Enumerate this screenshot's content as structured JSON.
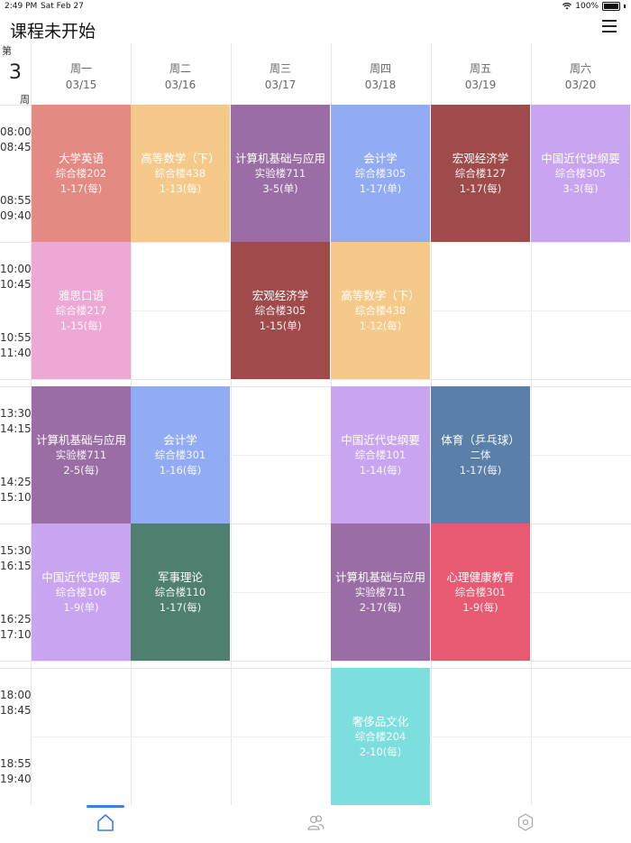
{
  "status_bar": {
    "time": "2:49 PM",
    "date": "Sat Feb 27",
    "battery": "100%"
  },
  "header": {
    "title": "课程未开始"
  },
  "week": {
    "prefix": "第",
    "number": "3",
    "suffix": "周"
  },
  "days": [
    {
      "name": "周一",
      "date": "03/15"
    },
    {
      "name": "周二",
      "date": "03/16"
    },
    {
      "name": "周三",
      "date": "03/17"
    },
    {
      "name": "周四",
      "date": "03/18"
    },
    {
      "name": "周五",
      "date": "03/19"
    },
    {
      "name": "周六",
      "date": "03/20"
    }
  ],
  "periods": [
    {
      "start": "08:00",
      "end": "08:45"
    },
    {
      "start": "08:55",
      "end": "09:40"
    },
    {
      "start": "10:00",
      "end": "10:45"
    },
    {
      "start": "10:55",
      "end": "11:40"
    },
    {
      "start": "13:30",
      "end": "14:15"
    },
    {
      "start": "14:25",
      "end": "15:10"
    },
    {
      "start": "15:30",
      "end": "16:15"
    },
    {
      "start": "16:25",
      "end": "17:10"
    },
    {
      "start": "18:00",
      "end": "18:45"
    },
    {
      "start": "18:55",
      "end": "19:40"
    }
  ],
  "courses": [
    {
      "day": 0,
      "block": 0,
      "name": "大学英语",
      "room": "综合楼202",
      "weeks": "1-17(每)",
      "color": "#e58a82"
    },
    {
      "day": 1,
      "block": 0,
      "name": "高等数学（下）",
      "room": "综合楼438",
      "weeks": "1-13(每)",
      "color": "#f5c98a"
    },
    {
      "day": 2,
      "block": 0,
      "name": "计算机基础与应用",
      "room": "实验楼711",
      "weeks": "3-5(单)",
      "color": "#9a6ea4"
    },
    {
      "day": 3,
      "block": 0,
      "name": "会计学",
      "room": "综合楼305",
      "weeks": "1-17(单)",
      "color": "#92abf5"
    },
    {
      "day": 4,
      "block": 0,
      "name": "宏观经济学",
      "room": "综合楼127",
      "weeks": "1-17(每)",
      "color": "#a04b4b"
    },
    {
      "day": 5,
      "block": 0,
      "name": "中国近代史纲要",
      "room": "综合楼305",
      "weeks": "3-3(每)",
      "color": "#c9a4f0"
    },
    {
      "day": 0,
      "block": 1,
      "name": "雅思口语",
      "room": "综合楼217",
      "weeks": "1-15(每)",
      "color": "#eea8d6"
    },
    {
      "day": 2,
      "block": 1,
      "name": "宏观经济学",
      "room": "综合楼305",
      "weeks": "1-15(单)",
      "color": "#a04b4b"
    },
    {
      "day": 3,
      "block": 1,
      "name": "高等数学（下）",
      "room": "综合楼438",
      "weeks": "1-12(每)",
      "color": "#f5c98a"
    },
    {
      "day": 0,
      "block": 2,
      "name": "计算机基础与应用",
      "room": "实验楼711",
      "weeks": "2-5(每)",
      "color": "#9a6ea4"
    },
    {
      "day": 1,
      "block": 2,
      "name": "会计学",
      "room": "综合楼301",
      "weeks": "1-16(每)",
      "color": "#92abf5"
    },
    {
      "day": 3,
      "block": 2,
      "name": "中国近代史纲要",
      "room": "综合楼101",
      "weeks": "1-14(每)",
      "color": "#c9a4f0"
    },
    {
      "day": 4,
      "block": 2,
      "name": "体育（乒乓球）",
      "room": "二体",
      "weeks": "1-17(每)",
      "color": "#5a7fa8"
    },
    {
      "day": 0,
      "block": 3,
      "name": "中国近代史纲要",
      "room": "综合楼106",
      "weeks": "1-9(单)",
      "color": "#c9a4f0"
    },
    {
      "day": 1,
      "block": 3,
      "name": "军事理论",
      "room": "综合楼110",
      "weeks": "1-17(每)",
      "color": "#4f7f6f"
    },
    {
      "day": 3,
      "block": 3,
      "name": "计算机基础与应用",
      "room": "实验楼711",
      "weeks": "2-17(每)",
      "color": "#9a6ea4"
    },
    {
      "day": 4,
      "block": 3,
      "name": "心理健康教育",
      "room": "综合楼301",
      "weeks": "1-9(每)",
      "color": "#e85a72"
    },
    {
      "day": 3,
      "block": 4,
      "name": "奢侈品文化",
      "room": "综合楼204",
      "weeks": "2-10(每)",
      "color": "#7ddede"
    }
  ],
  "tabs": [
    {
      "icon": "home-icon",
      "active": true
    },
    {
      "icon": "people-icon",
      "active": false
    },
    {
      "icon": "hexagon-settings-icon",
      "active": false
    }
  ],
  "colors": {
    "accent": "#3d7fe0",
    "grid_line": "#e6e6e6"
  }
}
